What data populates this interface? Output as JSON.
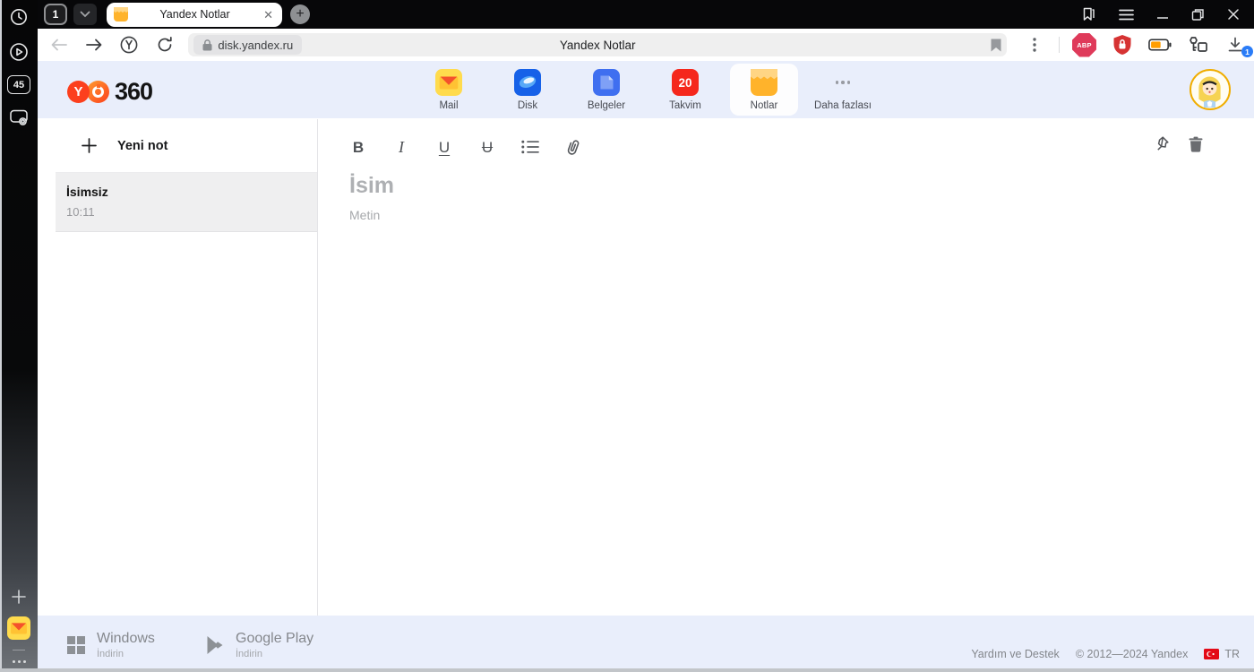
{
  "browser": {
    "tab_count": "1",
    "active_tab_title": "Yandex Notlar",
    "url_host": "disk.yandex.ru",
    "omnibox_title": "Yandex Notlar",
    "abp_label": "ABP",
    "download_badge": "1"
  },
  "rail": {
    "speed_score": "45"
  },
  "header": {
    "logo_suffix": "360",
    "apps": [
      {
        "label": "Mail"
      },
      {
        "label": "Disk"
      },
      {
        "label": "Belgeler"
      },
      {
        "label": "Takvim",
        "badge": "20"
      },
      {
        "label": "Notlar",
        "selected": true
      },
      {
        "label": "Daha fazlası"
      }
    ]
  },
  "notes_panel": {
    "new_note_label": "Yeni not",
    "notes": [
      {
        "title": "İsimsiz",
        "time": "10:11",
        "selected": true
      }
    ]
  },
  "editor": {
    "format": {
      "bold": "B",
      "italic": "I",
      "underline": "U",
      "strikethrough": "U"
    },
    "title_placeholder": "İsim",
    "body_placeholder": "Metin"
  },
  "footer": {
    "windows_title": "Windows",
    "windows_subtitle": "İndirin",
    "gplay_title": "Google Play",
    "gplay_subtitle": "İndirin",
    "help": "Yardım ve Destek",
    "copyright": "© 2012—2024 Yandex",
    "language": "TR"
  },
  "colors": {
    "header_bg": "#e9eefb",
    "accent_red": "#fc3f1d",
    "calendar_red": "#f5271c",
    "notes_orange": "#ffb32b",
    "download_badge_blue": "#2a7cf7",
    "selected_note_bg": "#efeff0"
  },
  "icons": {
    "history": "clock",
    "sessions": "play-circle",
    "screenshot": "camera",
    "new-panel": "plus",
    "mail-shortcut": "envelope",
    "rail-more": "ellipsis",
    "tab-favicon": "notes-pad",
    "bookmarks-panel": "ribbon",
    "menu": "hamburger",
    "lock": "padlock",
    "bookmark": "filled-ribbon",
    "kebab": "vertical-dots",
    "protect": "shield-lock",
    "battery": "battery",
    "passwords": "key",
    "downloads": "arrow-down",
    "pin": "pushpin",
    "delete": "trash",
    "list": "bulleted-list",
    "attach": "paperclip"
  }
}
